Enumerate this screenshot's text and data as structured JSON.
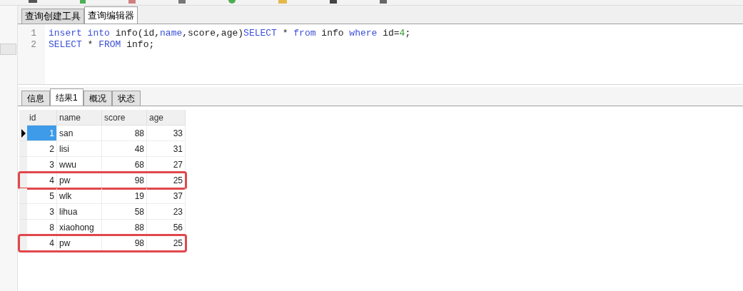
{
  "editor_tabs": [
    {
      "label": "查询创建工具",
      "selected": false
    },
    {
      "label": "查询编辑器",
      "selected": true
    }
  ],
  "editor": {
    "lines": [
      {
        "number": "1",
        "tokens": [
          {
            "text": "insert",
            "kind": "keyword"
          },
          {
            "text": " into",
            "kind": "keyword"
          },
          {
            "text": " info(id,",
            "kind": "plain"
          },
          {
            "text": "name",
            "kind": "keyword"
          },
          {
            "text": ",score,age)",
            "kind": "plain"
          },
          {
            "text": "SELECT",
            "kind": "keyword"
          },
          {
            "text": " * ",
            "kind": "plain"
          },
          {
            "text": "from",
            "kind": "keyword"
          },
          {
            "text": " info ",
            "kind": "plain"
          },
          {
            "text": "where",
            "kind": "keyword"
          },
          {
            "text": " id=",
            "kind": "plain"
          },
          {
            "text": "4",
            "kind": "number"
          },
          {
            "text": ";",
            "kind": "plain"
          }
        ]
      },
      {
        "number": "2",
        "tokens": [
          {
            "text": "SELECT",
            "kind": "keyword"
          },
          {
            "text": " * ",
            "kind": "plain"
          },
          {
            "text": "FROM",
            "kind": "keyword"
          },
          {
            "text": " info;",
            "kind": "plain"
          }
        ]
      }
    ]
  },
  "result_tabs": [
    {
      "label": "信息",
      "selected": false
    },
    {
      "label": "结果1",
      "selected": true
    },
    {
      "label": "概况",
      "selected": false
    },
    {
      "label": "状态",
      "selected": false
    }
  ],
  "table": {
    "columns": [
      "id",
      "name",
      "score",
      "age"
    ],
    "rows": [
      {
        "cells": [
          "1",
          "san",
          "88",
          "33"
        ],
        "selected": true,
        "highlighted": false
      },
      {
        "cells": [
          "2",
          "lisi",
          "48",
          "31"
        ],
        "selected": false,
        "highlighted": false
      },
      {
        "cells": [
          "3",
          "wwu",
          "68",
          "27"
        ],
        "selected": false,
        "highlighted": false
      },
      {
        "cells": [
          "4",
          "pw",
          "98",
          "25"
        ],
        "selected": false,
        "highlighted": true
      },
      {
        "cells": [
          "5",
          "wlk",
          "19",
          "37"
        ],
        "selected": false,
        "highlighted": false
      },
      {
        "cells": [
          "3",
          "lihua",
          "58",
          "23"
        ],
        "selected": false,
        "highlighted": false
      },
      {
        "cells": [
          "8",
          "xiaohong",
          "88",
          "56"
        ],
        "selected": false,
        "highlighted": false
      },
      {
        "cells": [
          "4",
          "pw",
          "98",
          "25"
        ],
        "selected": false,
        "highlighted": true
      }
    ]
  }
}
